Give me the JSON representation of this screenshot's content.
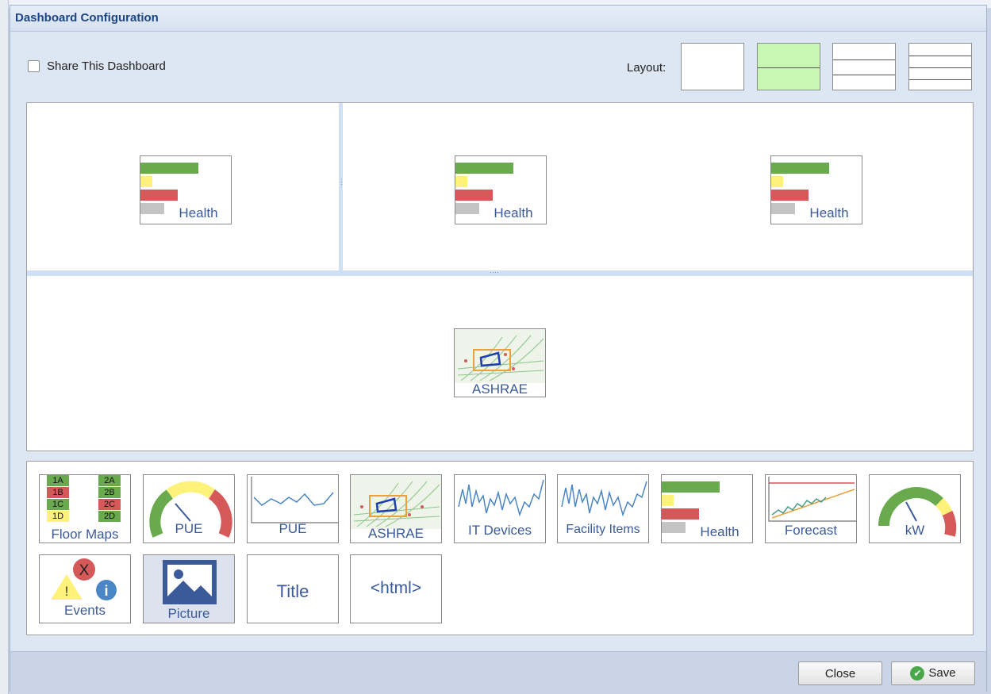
{
  "dialog": {
    "title": "Dashboard Configuration"
  },
  "share": {
    "label": "Share This Dashboard",
    "checked": false
  },
  "layout": {
    "label": "Layout:",
    "options": [
      "1 pane",
      "2 rows",
      "3 rows",
      "4 rows"
    ],
    "selected_index": 1
  },
  "canvas": {
    "top_widgets": [
      "Health",
      "Health",
      "Health"
    ],
    "bottom_widgets": [
      "ASHRAE"
    ]
  },
  "palette": {
    "row1": [
      "Floor Maps",
      "PUE",
      "PUE",
      "ASHRAE",
      "IT Devices",
      "Facility Items",
      "Health",
      "Forecast",
      "kW"
    ],
    "row2": [
      "Events",
      "Picture",
      "Title",
      "<html>"
    ],
    "floor_map_cells": [
      "1A",
      "2A",
      "1B",
      "2B",
      "1C",
      "2C",
      "1D",
      "2D"
    ],
    "events_glyphs": {
      "error": "X",
      "warning": "!",
      "info": "i"
    }
  },
  "buttons": {
    "close": "Close",
    "save": "Save"
  },
  "colors": {
    "title_text": "#1c4585",
    "selected_layout": "#c7f7b3",
    "health_green": "#6aaa4f",
    "health_yellow": "#fff27a",
    "health_red": "#d6595a",
    "health_gray": "#c4c4c4",
    "tile_label": "#3b5a9a",
    "save_icon": "#4aa84a"
  }
}
